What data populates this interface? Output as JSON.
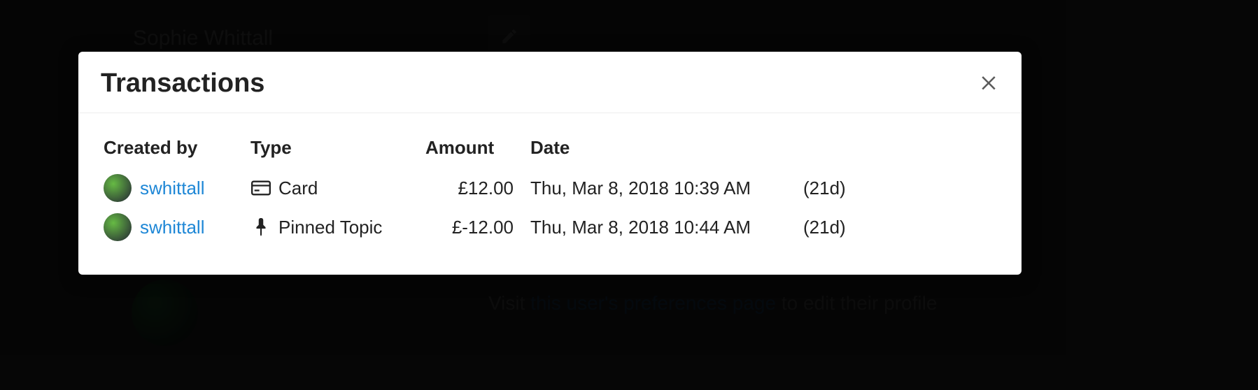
{
  "background": {
    "profile_name": "Sophie Whittall",
    "visit_prefix": "Visit ",
    "visit_link": "this user's preferences page",
    "visit_suffix": " to edit their profile"
  },
  "modal": {
    "title": "Transactions",
    "columns": {
      "created_by": "Created by",
      "type": "Type",
      "amount": "Amount",
      "date": "Date"
    },
    "rows": [
      {
        "username": "swhittall",
        "type_icon": "credit-card-icon",
        "type_label": "Card",
        "amount": "£12.00",
        "date": "Thu, Mar 8, 2018 10:39 AM",
        "ago": "(21d)"
      },
      {
        "username": "swhittall",
        "type_icon": "pin-icon",
        "type_label": "Pinned Topic",
        "amount": "£-12.00",
        "date": "Thu, Mar 8, 2018 10:44 AM",
        "ago": "(21d)"
      }
    ]
  }
}
